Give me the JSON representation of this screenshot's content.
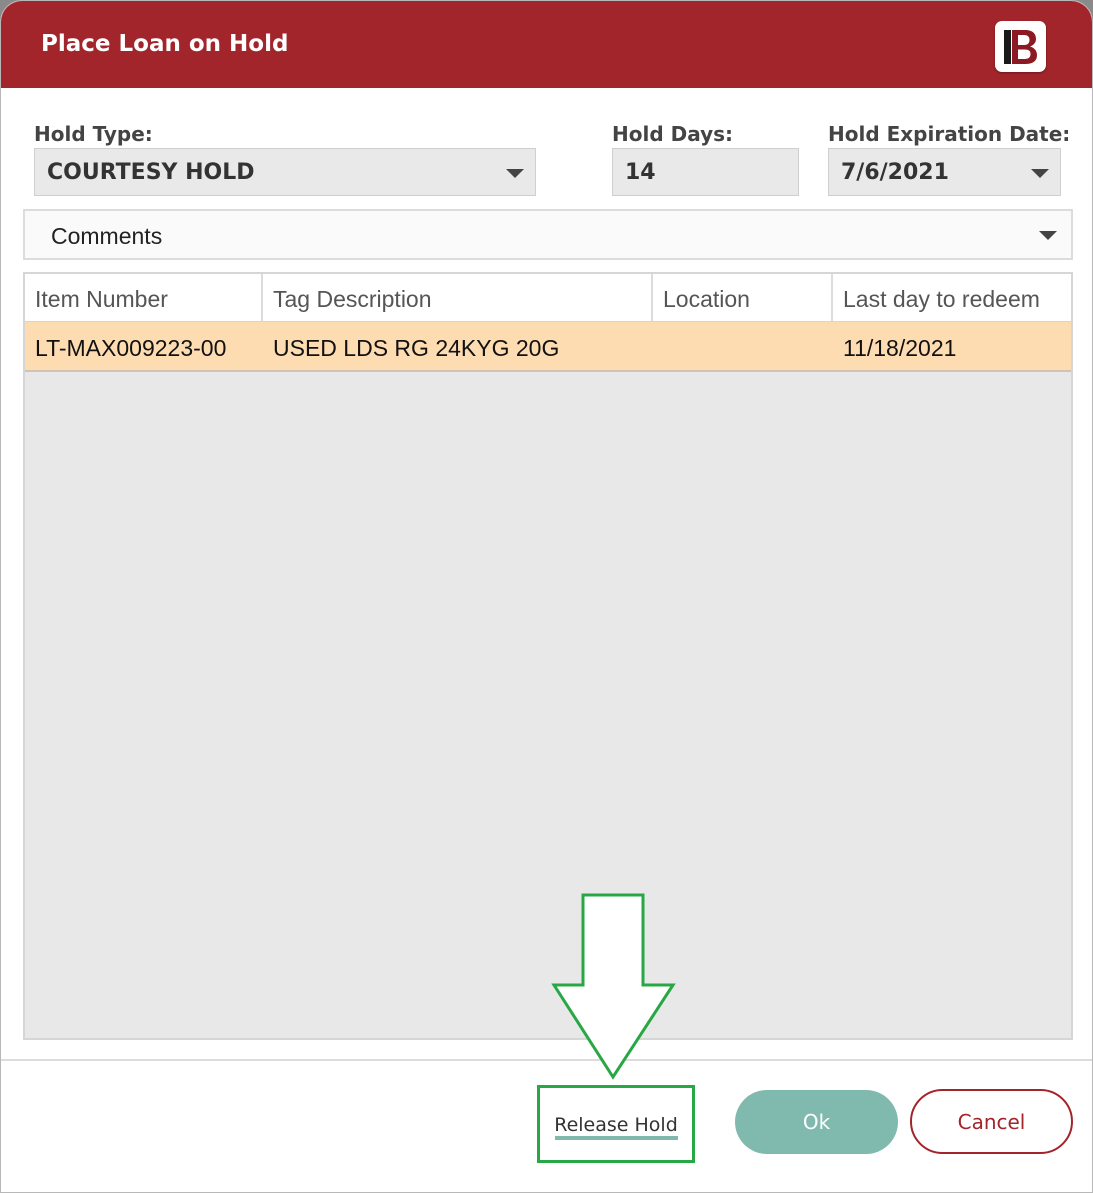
{
  "dialog": {
    "title": "Place Loan on Hold",
    "logo_icon": "b-brand-logo-icon"
  },
  "hold_type": {
    "label": "Hold Type:",
    "value": "COURTESY HOLD"
  },
  "hold_days": {
    "label": "Hold Days:",
    "value": "14"
  },
  "hold_expiration": {
    "label": "Hold Expiration Date:",
    "value": "7/6/2021"
  },
  "comments": {
    "label": "Comments"
  },
  "grid": {
    "columns": [
      "Item Number",
      "Tag Description",
      "Location",
      "Last day to redeem"
    ],
    "rows": [
      {
        "item_number": "LT-MAX009223-00",
        "tag_description": "USED LDS RG 24KYG 20G",
        "location": "",
        "last_day": "11/18/2021"
      }
    ],
    "selected_row_color": "#fedcb2"
  },
  "footer": {
    "release_hold": "Release Hold",
    "ok": "Ok",
    "cancel": "Cancel"
  },
  "colors": {
    "brand": "#a1252b",
    "ok": "#80b9ae",
    "highlight": "#27a844"
  },
  "annotation": {
    "arrow_icon": "down-arrow-icon"
  }
}
